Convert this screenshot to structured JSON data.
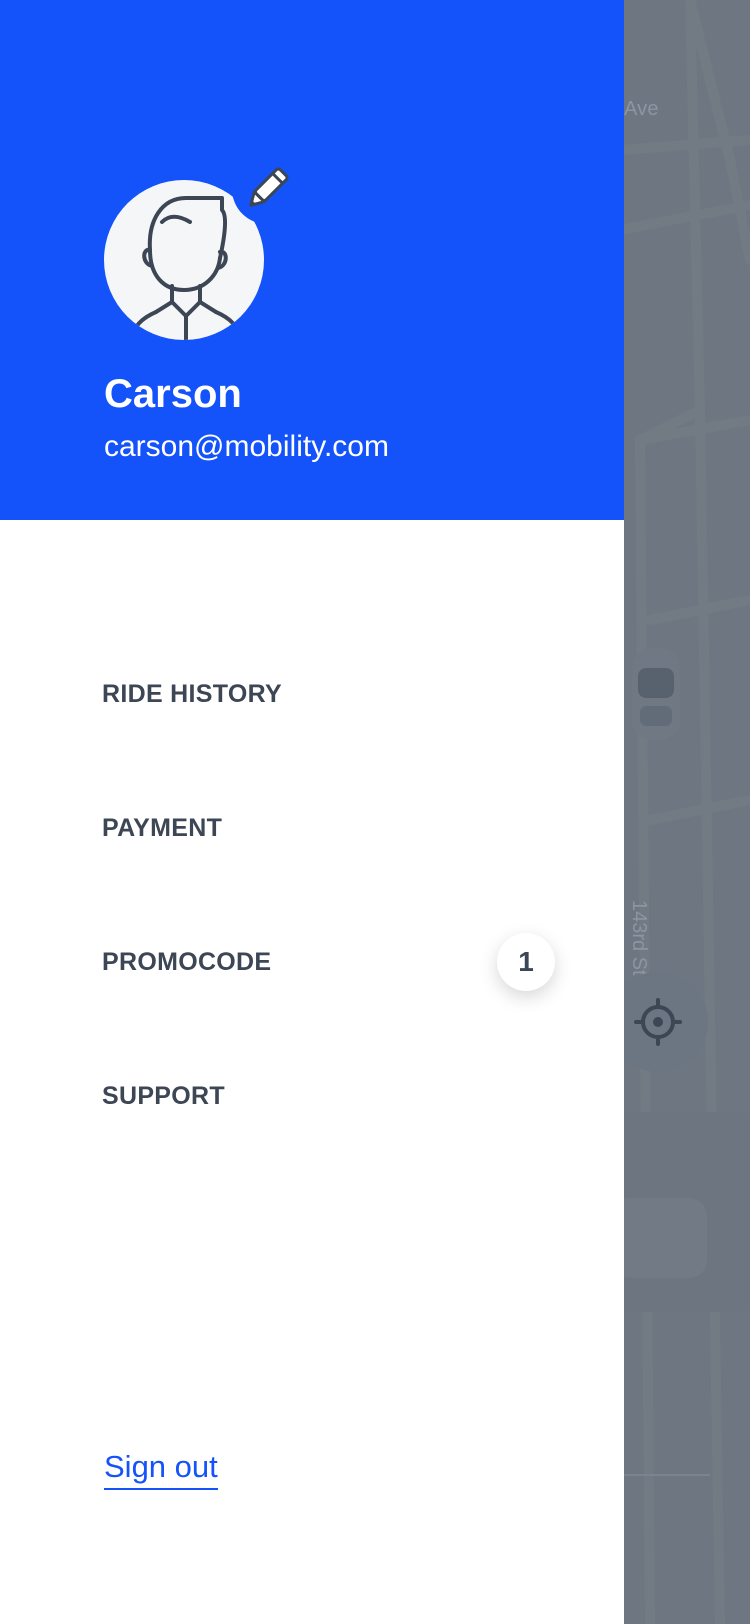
{
  "profile": {
    "name": "Carson",
    "email": "carson@mobility.com"
  },
  "menu": {
    "items": [
      {
        "label": "RIDE HISTORY"
      },
      {
        "label": "PAYMENT"
      },
      {
        "label": "PROMOCODE",
        "badge": "1"
      },
      {
        "label": "SUPPORT"
      }
    ]
  },
  "footer": {
    "sign_out": "Sign out"
  },
  "map": {
    "street_label_1": "Ave",
    "street_label_2": "143rd St"
  },
  "colors": {
    "brand": "#1453fa",
    "menu_text": "#3d4655",
    "overlay": "#646c78"
  },
  "icons": {
    "edit": "pencil-icon",
    "avatar": "user-avatar-icon",
    "locate": "crosshair-icon",
    "vehicle": "car-icon"
  }
}
